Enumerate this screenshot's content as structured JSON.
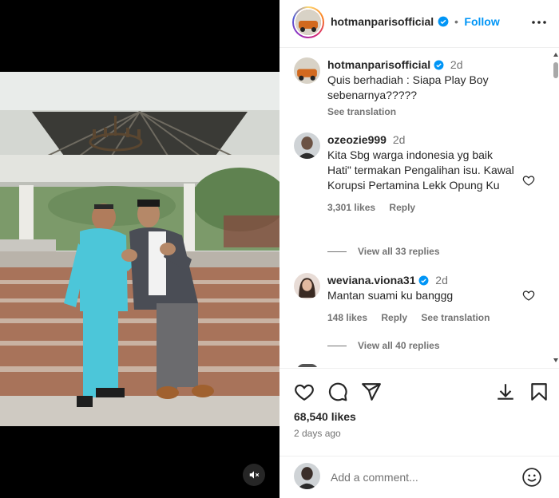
{
  "post": {
    "username": "hotmanparisofficial",
    "follow_label": "Follow",
    "separator": "•",
    "caption_username": "hotmanparisofficial",
    "caption_time": "2d",
    "caption_text": "Quis berhadiah : Siapa Play Boy sebenarnya?????",
    "see_translation": "See translation"
  },
  "comments": [
    {
      "username": "ozeozie999",
      "time": "2d",
      "text": "Kita Sbg warga indonesia yg baik Hati\" termakan Pengalihan isu. Kawal Korupsi Pertamina Lekk Opung Ku",
      "likes": "3,301 likes",
      "reply": "Reply",
      "view_replies": "View all 33 replies"
    },
    {
      "username": "weviana.viona31",
      "time": "2d",
      "text": "Mantan suami ku banggg",
      "likes": "148 likes",
      "reply": "Reply",
      "see_translation": "See translation",
      "view_replies": "View all 40 replies"
    }
  ],
  "footer": {
    "likes_count": "68,540 likes",
    "date": "2 days ago",
    "comment_placeholder": "Add a comment..."
  },
  "icons": {
    "verified": "verified-badge-icon",
    "more": "more-options-icon",
    "heart": "heart-icon",
    "comment": "comment-icon",
    "share": "share-icon",
    "save": "save-icon",
    "emoji": "emoji-icon",
    "mute": "mute-icon"
  },
  "colors": {
    "accent": "#0095f6",
    "text": "#262626",
    "muted": "#737373",
    "suit_turquoise": "#4cc6d9"
  }
}
